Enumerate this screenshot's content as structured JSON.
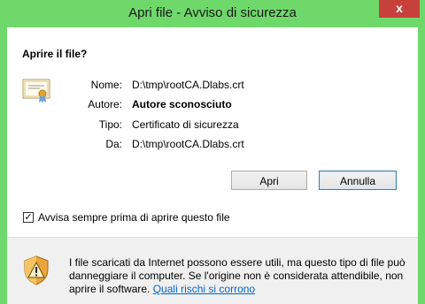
{
  "window": {
    "title": "Apri file - Avviso di sicurezza",
    "close_glyph": "x"
  },
  "dialog": {
    "heading": "Aprire il file?",
    "fields": [
      {
        "label": "Nome:",
        "value": "D:\\tmp\\rootCA.Dlabs.crt"
      },
      {
        "label": "Autore:",
        "value": "Autore sconosciuto"
      },
      {
        "label": "Tipo:",
        "value": "Certificato di sicurezza"
      },
      {
        "label": "Da:",
        "value": "D:\\tmp\\rootCA.Dlabs.crt"
      }
    ],
    "buttons": {
      "open": "Apri",
      "cancel": "Annulla"
    },
    "checkbox": {
      "label": "Avvisa sempre prima di aprire questo file",
      "checked": true,
      "mark": "✓"
    },
    "warning": {
      "text": "I file scaricati da Internet possono essere utili, ma questo tipo di file può danneggiare il computer. Se l'origine non è considerata attendibile, non aprire il software.",
      "link": "Quali rischi si corrono"
    }
  },
  "icons": {
    "certificate": "certificate-icon",
    "warning": "shield-warning-icon"
  },
  "colors": {
    "titlebar": "#6fd86b",
    "close": "#c7403a",
    "link": "#0066cc"
  }
}
